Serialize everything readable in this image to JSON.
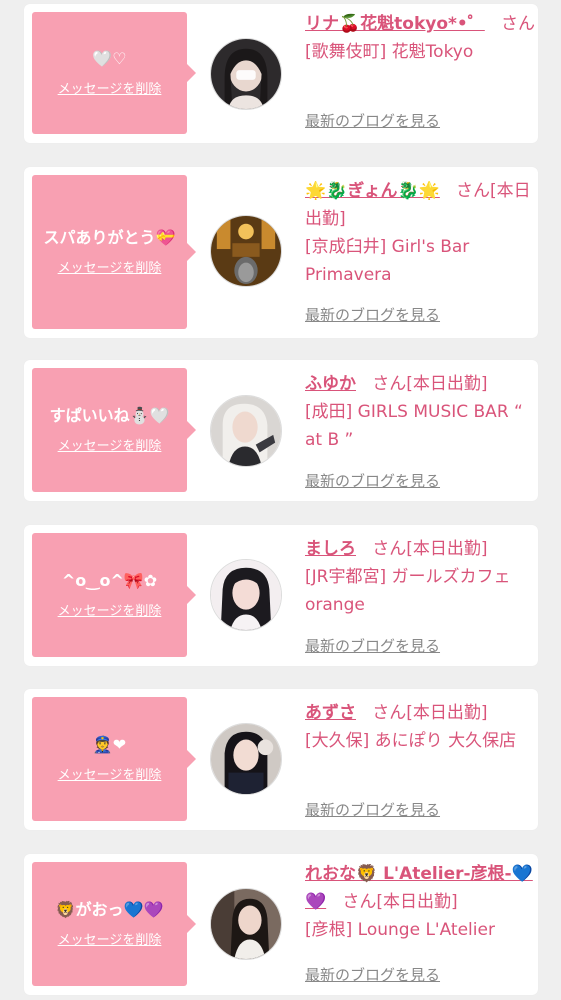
{
  "delete_label": "メッセージを削除",
  "blog_label": "最新のブログを見る",
  "san_suffix": "さん",
  "accent_color": "#d9547a",
  "bubble_color": "#f8a0b2",
  "items": [
    {
      "message": "🤍♡",
      "name": "リナ🍒花魁tokyo*•゜",
      "status": "",
      "shop": "[歌舞伎町] 花魁Tokyo"
    },
    {
      "message": "スパありがとう💝",
      "name": "🌟🐉ぎょん🐉🌟",
      "status": "[本日出勤]",
      "shop": "[京成臼井] Girl's Bar Primavera"
    },
    {
      "message": "すぱいいね⛄🤍",
      "name": "ふゆか",
      "status": "[本日出勤]",
      "shop": "[成田] GIRLS MUSIC BAR “ at B ”"
    },
    {
      "message": "^o‿o^🎀✿",
      "name": "ましろ",
      "status": "[本日出勤]",
      "shop": "[JR宇都宮] ガールズカフェ orange"
    },
    {
      "message": "👮❤",
      "name": "あずさ",
      "status": "[本日出勤]",
      "shop": "[大久保] あにぽり 大久保店"
    },
    {
      "message": "🦁がおっ💙💜",
      "name": "れおな🦁 L'Atelier-彦根-💙💜",
      "status": "[本日出勤]",
      "shop": "[彦根] Lounge L'Atelier"
    }
  ]
}
